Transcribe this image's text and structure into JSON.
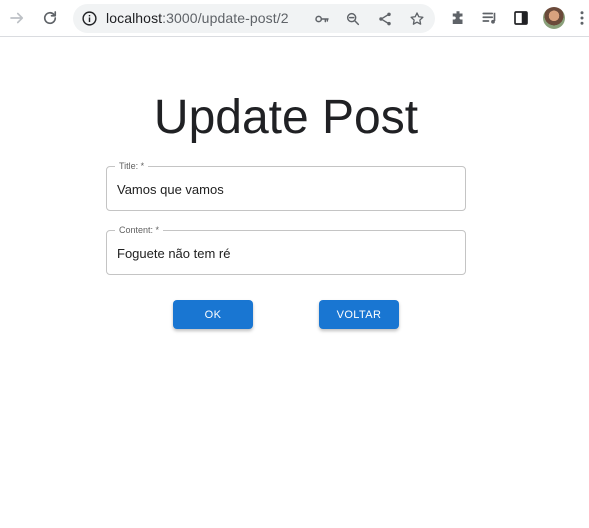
{
  "browser": {
    "url_host": "localhost",
    "url_rest": ":3000/update-post/2",
    "icons": [
      "forward-icon",
      "reload-icon",
      "info-icon",
      "key-icon",
      "zoom-icon",
      "share-icon",
      "star-icon",
      "extensions-icon",
      "media-icon",
      "sidepanel-icon",
      "profile-avatar",
      "menu-icon"
    ]
  },
  "page": {
    "title": "Update Post"
  },
  "form": {
    "title_label": "Title: *",
    "title_value": "Vamos que vamos",
    "content_label": "Content: *",
    "content_value": "Foguete não tem ré",
    "ok_label": "OK",
    "back_label": "VOLTAR"
  },
  "colors": {
    "primary": "#1976d2",
    "text": "#202124",
    "border": "#c4c4c4"
  }
}
